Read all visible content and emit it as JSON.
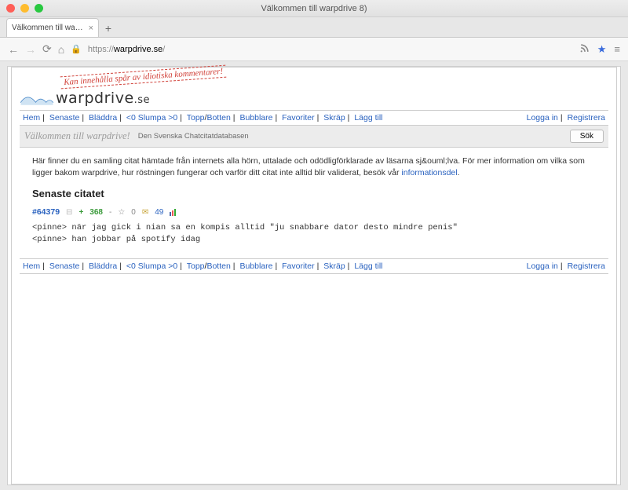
{
  "window": {
    "title": "Välkommen till warpdrive 8)"
  },
  "tab": {
    "title": "Välkommen till warpdrive 8)"
  },
  "url": {
    "proto": "https",
    "host": "warpdrive.se",
    "path": "/"
  },
  "stamp": "Kan innehålla spår av idiotiska kommentarer!",
  "logo": {
    "text": "warpdrive",
    "ext": ".se"
  },
  "nav": {
    "hem": "Hem",
    "senaste": "Senaste",
    "bladdra": "Bläddra",
    "slumpa_lt": "<0 Slumpa >0",
    "topp": "Topp",
    "botten": "Botten",
    "bubblare": "Bubblare",
    "favoriter": "Favoriter",
    "skrap": "Skräp",
    "lagg": "Lägg till"
  },
  "auth": {
    "login": "Logga in",
    "register": "Registrera"
  },
  "welcome": {
    "title": "Välkommen till warpdrive!",
    "tag": "Den Svenska Chatcitatdatabasen",
    "search_btn": "Sök"
  },
  "intro": {
    "text1": "Här finner du en samling citat hämtade från internets alla hörn, uttalade och odödligförklarade av läsarna sj&ouml;lva. För mer information om vilka som ligger bakom warpdrive, hur röstningen fungerar och varför ditt citat inte alltid blir validerat, besök vår ",
    "link": "informationsdel",
    "period": "."
  },
  "latest": {
    "heading": "Senaste citatet",
    "id_label": "#64379",
    "score": "368",
    "fav_count": "0",
    "comments": "49",
    "body": "<pinne> när jag gick i nian sa en kompis alltid \"ju snabbare dator desto mindre penis\"\n<pinne> han jobbar på spotify idag"
  }
}
